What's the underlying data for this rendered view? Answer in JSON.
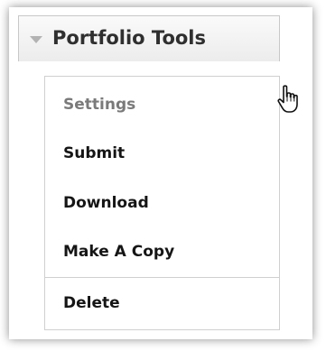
{
  "dropdown": {
    "label": "Portfolio Tools",
    "caret_icon": "caret-down-icon"
  },
  "menu": {
    "items": [
      {
        "label": "Settings",
        "state": "disabled"
      },
      {
        "label": "Submit"
      },
      {
        "label": "Download"
      },
      {
        "label": "Make A Copy"
      },
      {
        "label": "Delete"
      }
    ]
  },
  "cursor_icon": "hand-pointer-icon",
  "colors": {
    "text": "#151515",
    "disabled_text": "#7a7a7a",
    "border": "#d0d0d0",
    "caret": "#b3b3b3"
  }
}
